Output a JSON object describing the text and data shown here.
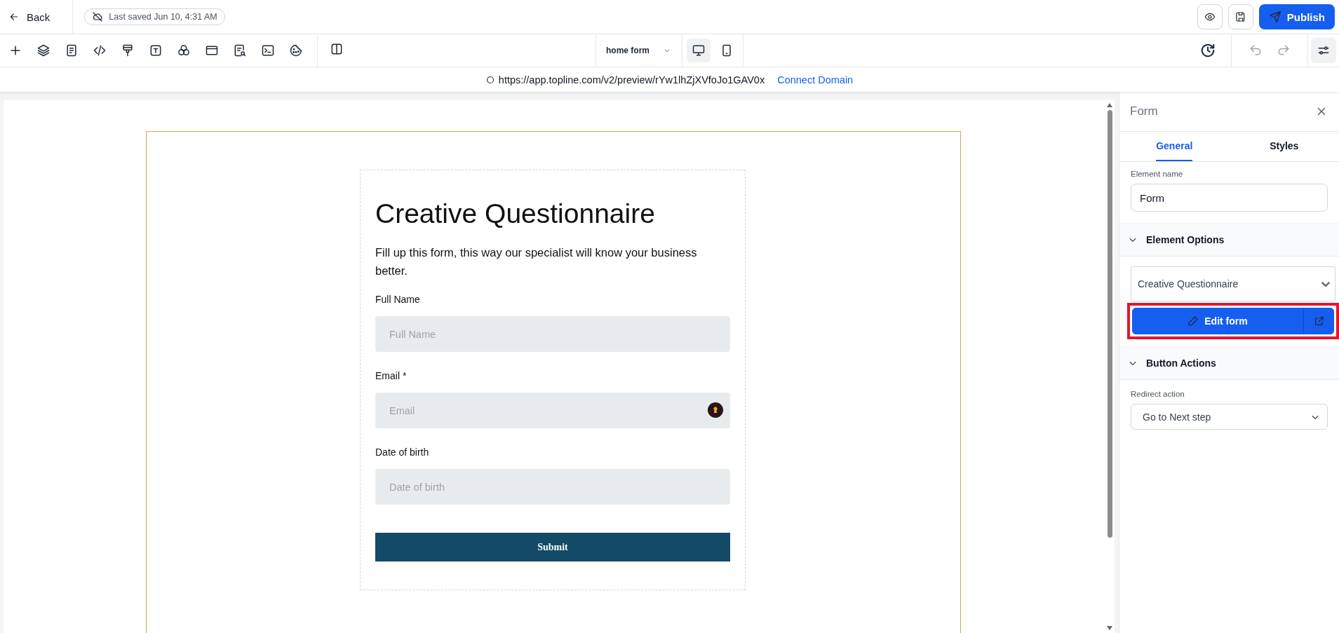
{
  "top_bar": {
    "back": "Back",
    "save_status": "Last saved Jun 10, 4:31 AM",
    "publish": "Publish"
  },
  "toolbar": {
    "page_selector": "home form",
    "devices": [
      {
        "kind": "desktop",
        "selected": true
      },
      {
        "kind": "mobile",
        "selected": false
      }
    ]
  },
  "url_bar": {
    "url": "https://app.topline.com/v2/preview/rYw1lhZjXVfoJo1GAV0x",
    "link": "Connect Domain"
  },
  "form": {
    "title": "Creative Questionnaire",
    "description": "Fill up this form, this way our specialist will know your business better.",
    "fields": [
      {
        "label": "Full Name",
        "placeholder": "Full Name",
        "kind": "text"
      },
      {
        "label": "Email *",
        "placeholder": "Email",
        "kind": "email"
      },
      {
        "label": "Date of birth",
        "placeholder": "Date of birth",
        "kind": "text"
      }
    ],
    "submit": "Submit"
  },
  "panel": {
    "title": "Form",
    "tabs": [
      {
        "label": "General",
        "selected": true
      },
      {
        "label": "Styles",
        "selected": false
      }
    ],
    "element_name_label": "Element name",
    "element_name": "Form",
    "sections": [
      {
        "title": "Element Options",
        "expanded": true,
        "select": "Creative Questionnaire",
        "button": "Edit form",
        "highlighted": true
      },
      {
        "title": "Button Actions",
        "expanded": true,
        "field_label": "Redirect action",
        "select": "Go to Next step"
      }
    ]
  }
}
